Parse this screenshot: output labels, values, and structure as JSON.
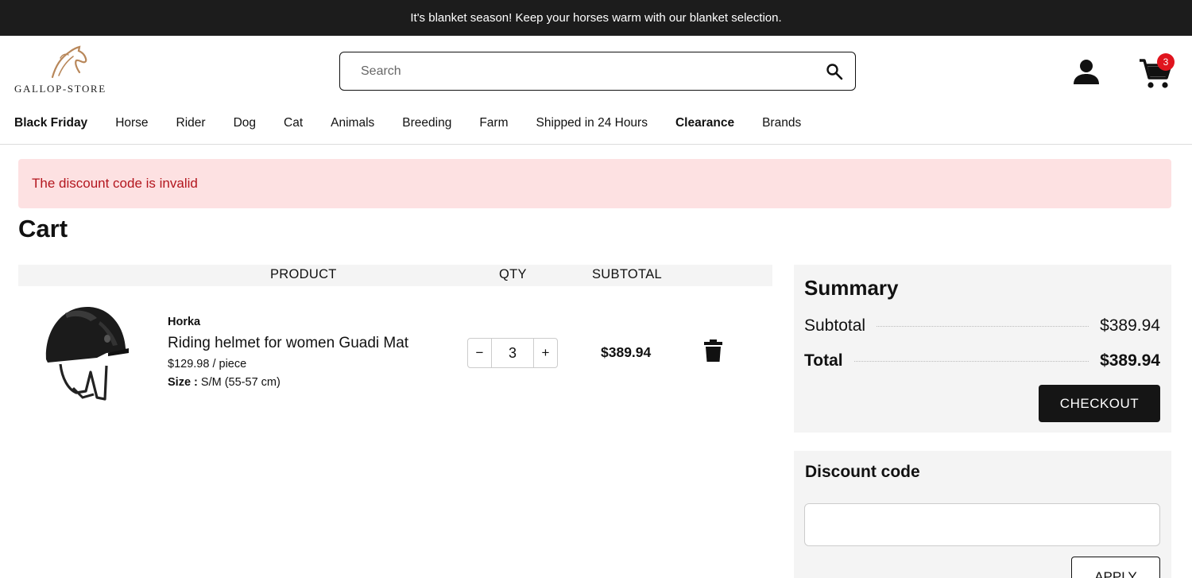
{
  "announcement": "It's blanket season! Keep your horses warm with our blanket selection.",
  "logo": {
    "text": "GALLOP-STORE"
  },
  "search": {
    "placeholder": "Search"
  },
  "cart": {
    "count": "3"
  },
  "nav": [
    {
      "label": "Black Friday",
      "bold": true
    },
    {
      "label": "Horse"
    },
    {
      "label": "Rider"
    },
    {
      "label": "Dog"
    },
    {
      "label": "Cat"
    },
    {
      "label": "Animals"
    },
    {
      "label": "Breeding"
    },
    {
      "label": "Farm"
    },
    {
      "label": "Shipped in 24 Hours"
    },
    {
      "label": "Clearance",
      "bold": true
    },
    {
      "label": "Brands"
    }
  ],
  "alert": {
    "message": "The discount code is invalid",
    "color": "#b3161e",
    "background": "#fde1e2"
  },
  "page": {
    "title": "Cart"
  },
  "table": {
    "headers": {
      "product": "PRODUCT",
      "qty": "QTY",
      "subtotal": "SUBTOTAL"
    }
  },
  "item": {
    "brand": "Horka",
    "name": "Riding helmet for women Guadi Mat",
    "unit_price": "$129.98 / piece",
    "size_label": "Size :",
    "size_value": "S/M (55-57 cm)",
    "qty": "3",
    "minus": "−",
    "plus": "+",
    "subtotal": "$389.94"
  },
  "summary": {
    "title": "Summary",
    "subtotal_label": "Subtotal",
    "subtotal_value": "$389.94",
    "total_label": "Total",
    "total_value": "$389.94",
    "checkout_label": "CHECKOUT"
  },
  "discount": {
    "title": "Discount code",
    "value": "",
    "apply_label": "APPLY"
  }
}
